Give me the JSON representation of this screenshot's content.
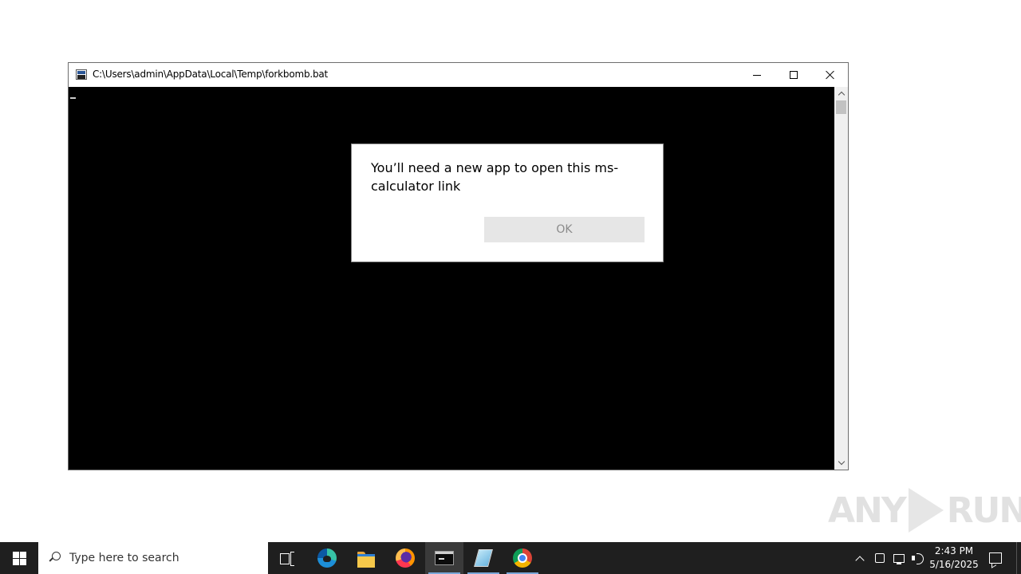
{
  "window": {
    "title": "C:\\Users\\admin\\AppData\\Local\\Temp\\forkbomb.bat"
  },
  "dialog": {
    "message": "You’ll need a new app to open this ms-calculator link",
    "ok_label": "OK"
  },
  "watermark": {
    "left": "ANY",
    "right": "RUN"
  },
  "taskbar": {
    "search_placeholder": "Type here to search",
    "pinned": [
      "task-view",
      "edge",
      "file-explorer",
      "firefox",
      "cmd",
      "notepad",
      "chrome"
    ],
    "active_app": "cmd",
    "clock_time": "2:43 PM",
    "clock_date": "5/16/2025"
  }
}
